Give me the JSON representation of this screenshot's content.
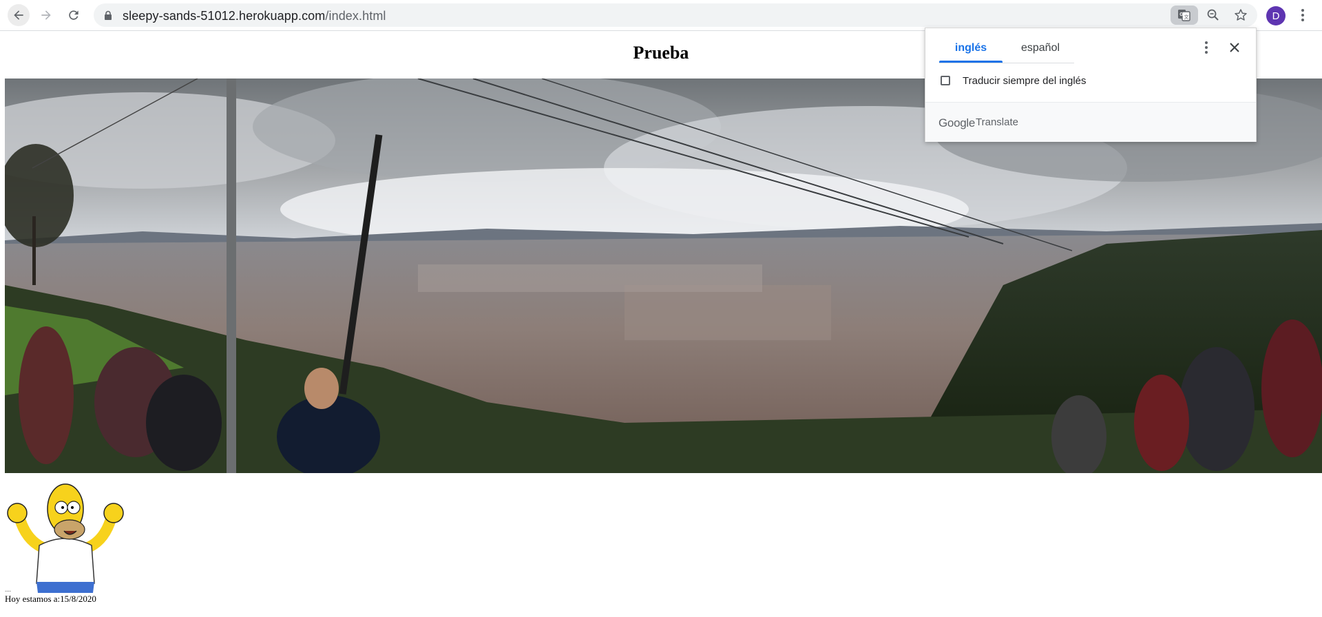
{
  "browser": {
    "url_host": "sleepy-sands-51012.herokuapp.com",
    "url_path": "/index.html",
    "avatar_letter": "D",
    "icons": {
      "back": "back-arrow-icon",
      "forward": "forward-arrow-icon",
      "reload": "reload-icon",
      "lock": "lock-icon",
      "translate": "translate-icon",
      "zoom": "zoom-icon",
      "bookmark": "star-icon",
      "menu": "more-vert-icon"
    }
  },
  "page": {
    "title": "Prueba",
    "date_text": "Hoy estamos a:15/8/2020",
    "broken_image_text": "....",
    "panorama_image": "mountain panorama of a city under cloudy sky",
    "homer_image": "cartoon character raising arms"
  },
  "translate_popup": {
    "tabs": [
      {
        "label": "inglés",
        "active": true
      },
      {
        "label": "español",
        "active": false
      }
    ],
    "always_translate_label": "Traducir siempre del inglés",
    "always_translate_checked": false,
    "brand_google": "Google",
    "brand_translate": "Translate"
  },
  "colors": {
    "accent": "#1a73e8",
    "avatar": "#5e35b1",
    "omnibox_bg": "#f1f3f4"
  }
}
